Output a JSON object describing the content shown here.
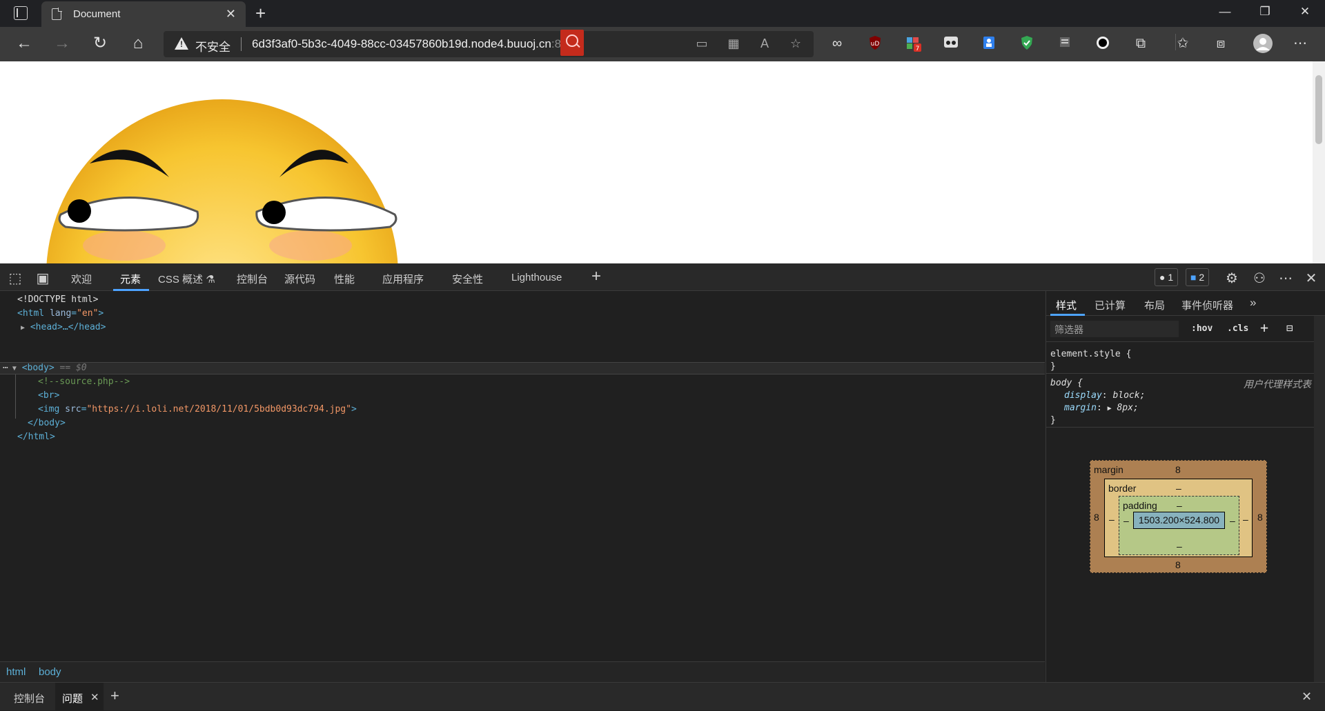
{
  "browser": {
    "tab_title": "Document",
    "address": {
      "security_label": "不安全",
      "url_main": "6d3f3af0-5b3c-4049-88cc-03457860b19d.node4.buuoj.cn",
      "url_port": ":81"
    },
    "extensions": [
      "infinity-icon",
      "ublock-icon",
      "puzzle-badge-icon",
      "glasses-icon",
      "bookmark-icon",
      "shield-icon",
      "reader-icon",
      "circle-icon",
      "extensions-icon",
      "favorites-icon",
      "collections-icon",
      "profile-icon",
      "more-icon"
    ],
    "ext_badge_count": "7"
  },
  "devtools": {
    "tabs": [
      "欢迎",
      "元素",
      "CSS 概述",
      "控制台",
      "源代码",
      "性能",
      "应用程序",
      "安全性",
      "Lighthouse"
    ],
    "active_tab": "元素",
    "error_badge": "1",
    "issue_badge": "2",
    "elements": {
      "doctype": "<!DOCTYPE html>",
      "html_open_tag": "html",
      "html_attr_name": "lang",
      "html_attr_val": "\"en\"",
      "head_text": "<head>…</head>",
      "body_tag": "<body>",
      "body_marker": "== $0",
      "comment": "<!--source.php-->",
      "br": "<br>",
      "img_tag_start": "<img ",
      "img_attr_name": "src",
      "img_attr_val": "\"https://i.loli.net/2018/11/01/5bdb0d93dc794.jpg\"",
      "img_tag_end": ">",
      "body_close": "</body>",
      "html_close": "</html>"
    },
    "breadcrumbs": [
      "html",
      "body"
    ],
    "styles": {
      "tabs": [
        "样式",
        "已计算",
        "布局",
        "事件侦听器"
      ],
      "filter_placeholder": "筛选器",
      "hov": ":hov",
      "cls": ".cls",
      "element_style_open": "element.style {",
      "close_brace": "}",
      "body_selector": "body {",
      "ua_label": "用户代理样式表",
      "prop_display": "display",
      "val_display": "block;",
      "prop_margin": "margin",
      "val_margin": "8px;"
    },
    "box_model": {
      "margin_label": "margin",
      "margin_top": "8",
      "margin_right": "8",
      "margin_bottom": "8",
      "margin_left": "8",
      "border_label": "border",
      "border_top": "–",
      "border_bottom": "–",
      "padding_label": "padding",
      "padding_top": "–",
      "padding_bottom": "–",
      "padding_left": "–",
      "padding_right": "–",
      "border_left": "–",
      "border_right": "–",
      "content_size": "1503.200×524.800"
    },
    "drawer": {
      "tabs": [
        "控制台",
        "问题"
      ],
      "active_tab": "问题"
    }
  }
}
